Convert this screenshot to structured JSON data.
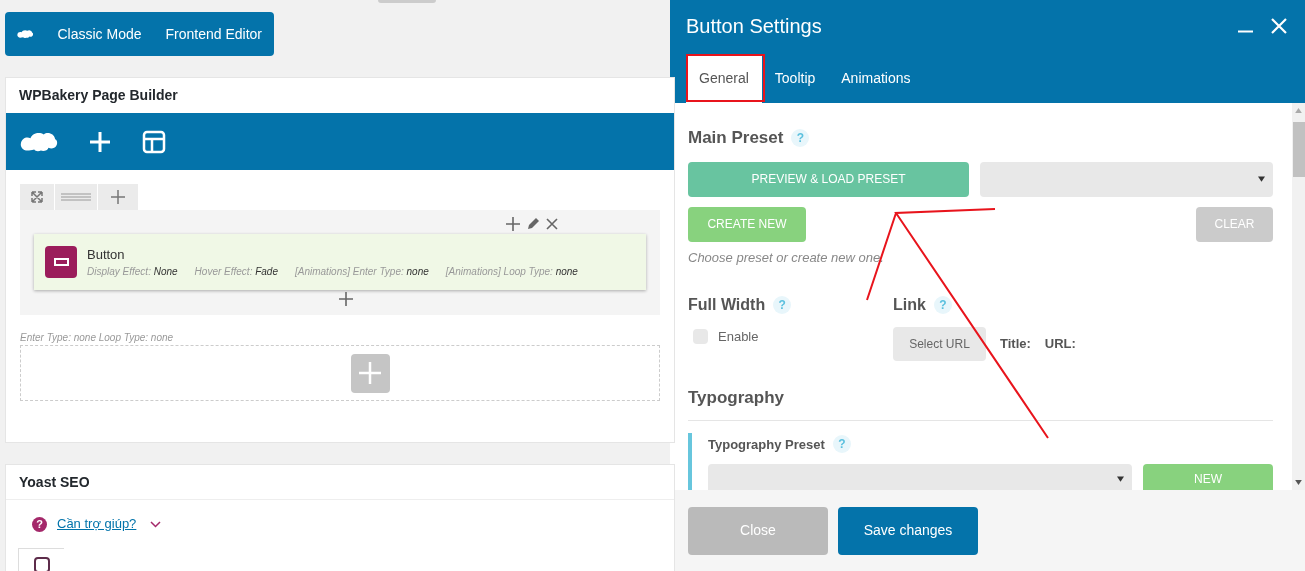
{
  "mode_bar": {
    "items": [
      {
        "label": "Classic Mode"
      },
      {
        "label": "Frontend Editor"
      }
    ]
  },
  "builder": {
    "title": "WPBakery Page Builder",
    "element": {
      "title": "Button",
      "params": [
        {
          "label": "Display Effect:",
          "value": "None"
        },
        {
          "label": "Hover Effect:",
          "value": "Fade"
        },
        {
          "label": "[Animations] Enter Type:",
          "value": "none"
        },
        {
          "label": "[Animations] Loop Type:",
          "value": "none"
        }
      ]
    },
    "section_note": "Enter Type: none  Loop Type: none"
  },
  "yoast": {
    "title": "Yoast SEO",
    "help_icon": "?",
    "help_link": "Cần trợ giúp?"
  },
  "modal": {
    "title": "Button Settings",
    "tabs": [
      {
        "label": "General",
        "selected": true
      },
      {
        "label": "Tooltip",
        "selected": false
      },
      {
        "label": "Animations",
        "selected": false
      }
    ],
    "main_preset": {
      "heading": "Main Preset",
      "help": "?",
      "preview_button": "PREVIEW & LOAD PRESET",
      "create_button": "CREATE NEW",
      "clear_button": "CLEAR",
      "hint": "Choose preset or create new one."
    },
    "full_width": {
      "heading": "Full Width",
      "help": "?",
      "checkbox_label": "Enable",
      "checked": false
    },
    "link": {
      "heading": "Link",
      "help": "?",
      "select_button": "Select URL",
      "title_label": "Title:",
      "url_label": "URL:"
    },
    "typography": {
      "heading": "Typography",
      "preset_label": "Typography Preset",
      "help": "?",
      "new_button": "NEW"
    },
    "footer": {
      "close_button": "Close",
      "save_button": "Save changes"
    }
  }
}
